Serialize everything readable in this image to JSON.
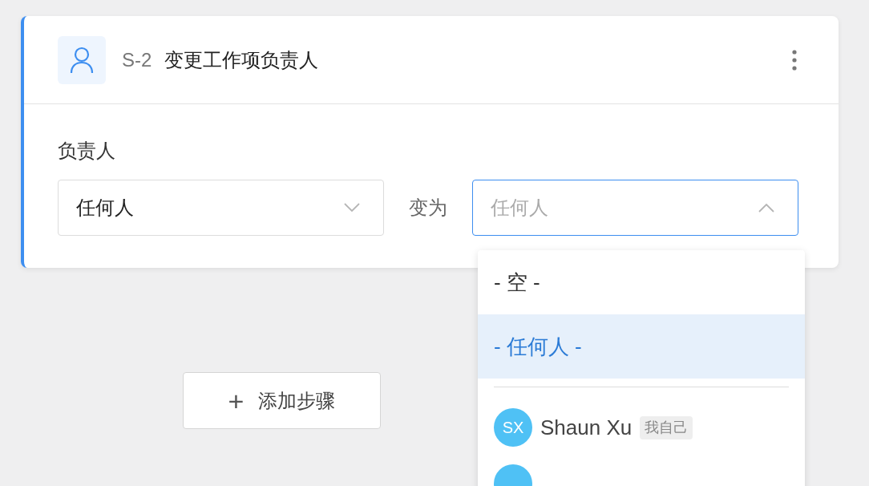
{
  "step": {
    "code": "S-2",
    "title": "变更工作项负责人"
  },
  "field": {
    "label": "负责人",
    "from_value": "任何人",
    "connector": "变为",
    "to_placeholder": "任何人",
    "to_open": true
  },
  "dropdown": {
    "options": [
      {
        "kind": "text",
        "label": "- 空 -",
        "selected": false
      },
      {
        "kind": "text",
        "label": "- 任何人 -",
        "selected": true
      },
      {
        "kind": "divider"
      },
      {
        "kind": "user",
        "initials": "SX",
        "name": "Shaun Xu",
        "tag": "我自己",
        "selected": false
      },
      {
        "kind": "user_cut",
        "selected": false
      }
    ]
  },
  "add_button": {
    "icon": "+",
    "label": "添加步骤"
  }
}
